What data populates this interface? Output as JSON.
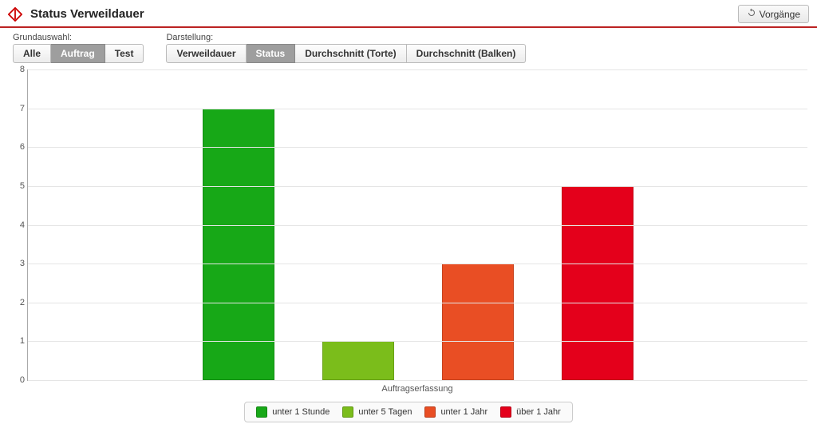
{
  "header": {
    "title": "Status Verweildauer",
    "actions_label": "Vorgänge"
  },
  "filters": {
    "grundauswahl_label": "Grundauswahl:",
    "grundauswahl": {
      "alle": "Alle",
      "auftrag": "Auftrag",
      "test": "Test"
    },
    "darstellung_label": "Darstellung:",
    "darstellung": {
      "verweildauer": "Verweildauer",
      "status": "Status",
      "durchschnitt_torte": "Durchschnitt (Torte)",
      "durchschnitt_balken": "Durchschnitt (Balken)"
    }
  },
  "chart_data": {
    "type": "bar",
    "categories": [
      "Auftragserfassung"
    ],
    "series": [
      {
        "name": "unter 1 Stunde",
        "color": "#17a817",
        "values": [
          7
        ]
      },
      {
        "name": "unter 5 Tagen",
        "color": "#7bbd1b",
        "values": [
          1
        ]
      },
      {
        "name": "unter 1 Jahr",
        "color": "#e94e24",
        "values": [
          3
        ]
      },
      {
        "name": "über 1 Jahr",
        "color": "#e4001b",
        "values": [
          5
        ]
      }
    ],
    "ylim": [
      0,
      8
    ],
    "y_ticks": [
      0,
      1,
      2,
      3,
      4,
      5,
      6,
      7,
      8
    ],
    "xlabel": "Auftragserfassung",
    "ylabel": "",
    "title": ""
  }
}
